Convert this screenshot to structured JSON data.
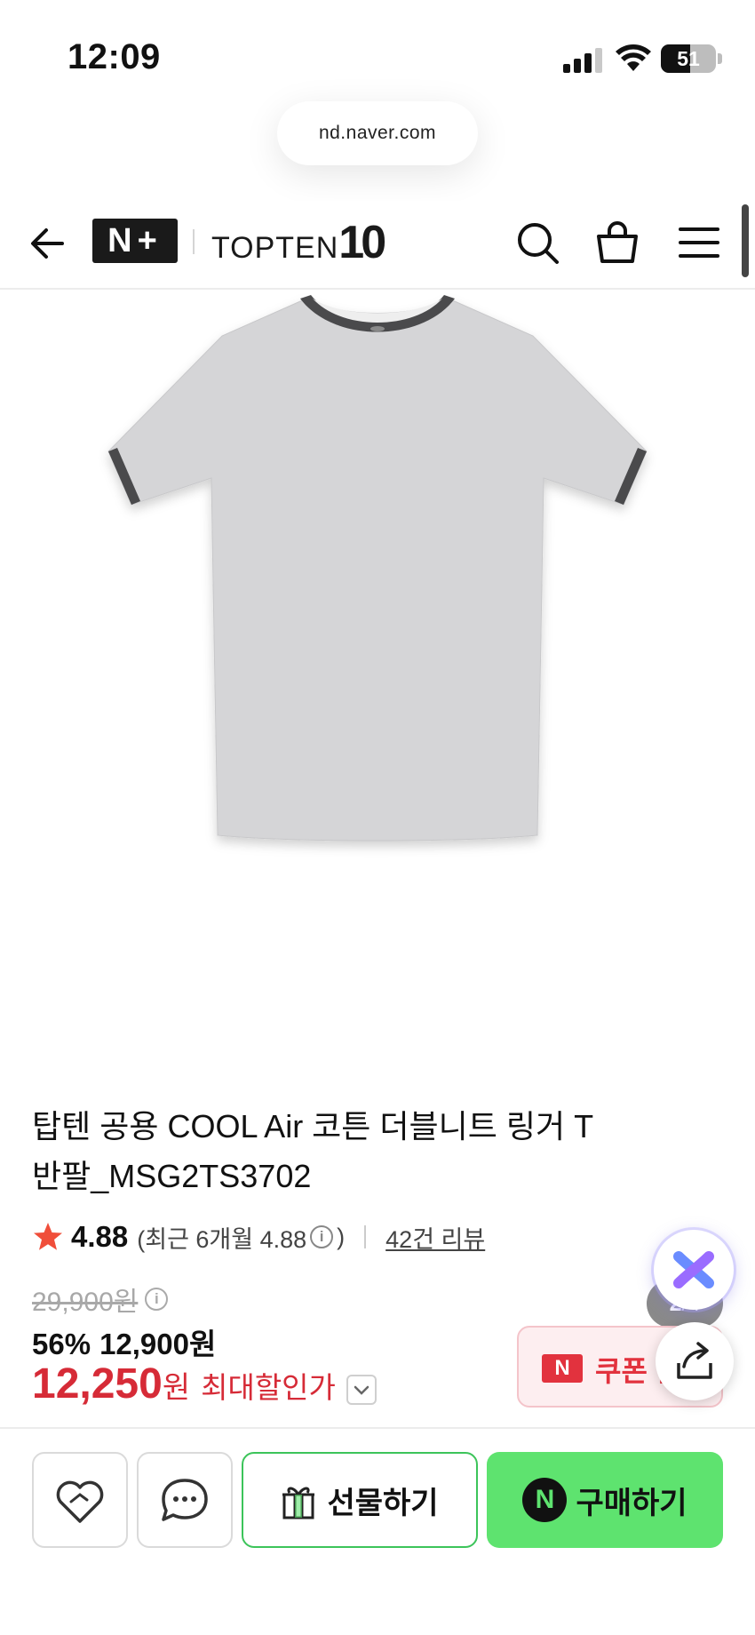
{
  "status_bar": {
    "time": "12:09",
    "battery": "51"
  },
  "browser": {
    "url": "nd.naver.com"
  },
  "header": {
    "partner_logo": "N+",
    "brand_prefix": "TOPTEN",
    "brand_suffix": "10"
  },
  "gallery": {
    "current": "2",
    "separator": "/",
    "total": "4"
  },
  "product": {
    "title": "탑텐 공용 COOL Air 코튼 더블니트 링거 T 반팔_MSG2TS3702",
    "rating": "4.88",
    "recent_rating_text": "(최근 6개월 4.88",
    "recent_rating_close": ")",
    "review_count": "42건 리뷰",
    "original_price": "29,900원",
    "discount_percent": "56%",
    "discount_price": "12,900원",
    "final_price": "12,250",
    "final_unit": "원",
    "max_discount_label": "최대할인가"
  },
  "coupon": {
    "logo": "N",
    "label": "쿠폰 받"
  },
  "actions": {
    "gift_label": "선물하기",
    "buy_label": "구매하기",
    "buy_logo": "N"
  },
  "colors": {
    "accent_red": "#d62b37",
    "npay_green": "#5ee36f",
    "gift_border": "#3cc45a",
    "star": "#f04e3a"
  },
  "icons": {
    "back": "arrow-left-icon",
    "search": "search-icon",
    "cart": "shopping-bag-icon",
    "menu": "hamburger-menu-icon",
    "wishlist": "heart-icon",
    "chat": "chat-bubble-icon",
    "gift": "gift-box-icon",
    "share": "share-icon",
    "ai": "ai-assistant-icon"
  }
}
